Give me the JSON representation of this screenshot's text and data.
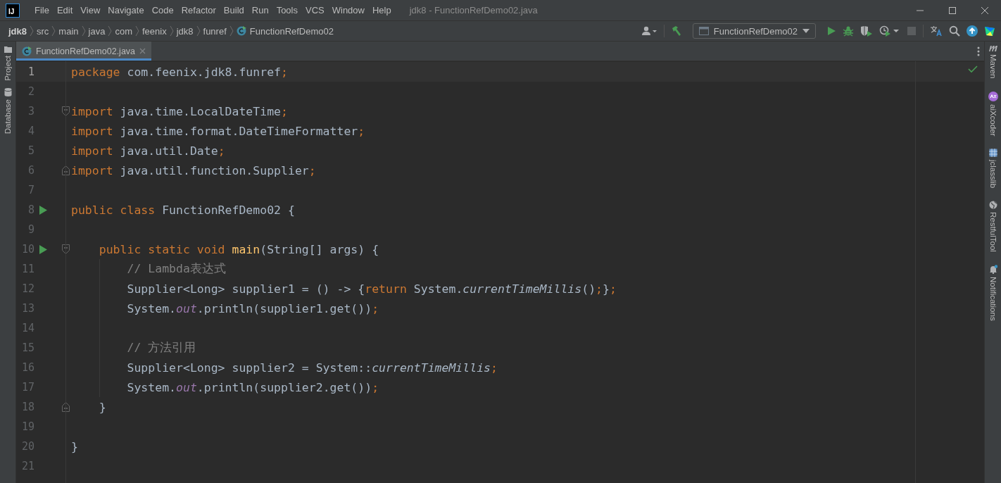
{
  "window": {
    "title": "jdk8 - FunctionRefDemo02.java",
    "logo_text": "IJ"
  },
  "menu": [
    "File",
    "Edit",
    "View",
    "Navigate",
    "Code",
    "Refactor",
    "Build",
    "Run",
    "Tools",
    "VCS",
    "Window",
    "Help"
  ],
  "breadcrumbs": [
    {
      "label": "jdk8",
      "kind": "project"
    },
    {
      "label": "src",
      "kind": "folder"
    },
    {
      "label": "main",
      "kind": "folder"
    },
    {
      "label": "java",
      "kind": "folder"
    },
    {
      "label": "com",
      "kind": "folder"
    },
    {
      "label": "feenix",
      "kind": "folder"
    },
    {
      "label": "jdk8",
      "kind": "folder"
    },
    {
      "label": "funref",
      "kind": "folder"
    },
    {
      "label": "FunctionRefDemo02",
      "kind": "class"
    }
  ],
  "run_config": {
    "label": "FunctionRefDemo02"
  },
  "tabs": [
    {
      "label": "FunctionRefDemo02.java",
      "selected": true
    }
  ],
  "left_tools": [
    "Project",
    "Database"
  ],
  "right_tools": [
    "Maven",
    "aiXcoder",
    "jclasslib",
    "RestfulTool",
    "Notifications"
  ],
  "editor": {
    "lines": [
      {
        "number": "1",
        "current": true,
        "run": false,
        "tokens": [
          {
            "kind": "kw",
            "text": "package"
          },
          {
            "kind": "pl",
            "text": " com.feenix.jdk8.funref"
          },
          {
            "kind": "op",
            "text": ";"
          }
        ]
      },
      {
        "number": "2",
        "current": false,
        "run": false
      },
      {
        "number": "3",
        "current": false,
        "run": false,
        "fold": {
          "kind": "start"
        },
        "tokens": [
          {
            "kind": "kw",
            "text": "import"
          },
          {
            "kind": "pl",
            "text": " java.time.LocalDateTime"
          },
          {
            "kind": "op",
            "text": ";"
          }
        ]
      },
      {
        "number": "4",
        "current": false,
        "run": false,
        "tokens": [
          {
            "kind": "kw",
            "text": "import"
          },
          {
            "kind": "pl",
            "text": " java.time.format.DateTimeFormatter"
          },
          {
            "kind": "op",
            "text": ";"
          }
        ]
      },
      {
        "number": "5",
        "current": false,
        "run": false,
        "tokens": [
          {
            "kind": "kw",
            "text": "import"
          },
          {
            "kind": "pl",
            "text": " java.util.Date"
          },
          {
            "kind": "op",
            "text": ";"
          }
        ]
      },
      {
        "number": "6",
        "current": false,
        "run": false,
        "fold": {
          "kind": "end"
        },
        "tokens": [
          {
            "kind": "kw",
            "text": "import"
          },
          {
            "kind": "pl",
            "text": " java.util.function.Supplier"
          },
          {
            "kind": "op",
            "text": ";"
          }
        ]
      },
      {
        "number": "7",
        "current": false,
        "run": false
      },
      {
        "number": "8",
        "current": false,
        "run": true,
        "tokens": [
          {
            "kind": "kw",
            "text": "public class"
          },
          {
            "kind": "pl",
            "text": " FunctionRefDemo02 {"
          }
        ]
      },
      {
        "number": "9",
        "current": false,
        "run": false
      },
      {
        "number": "10",
        "current": false,
        "run": true,
        "fold": {
          "kind": "start"
        },
        "tokens": [
          {
            "kind": "kw",
            "text": "    public static void"
          },
          {
            "kind": "fn",
            "text": " main"
          },
          {
            "kind": "pl",
            "text": "(String[] args) {"
          }
        ]
      },
      {
        "number": "11",
        "current": false,
        "run": false,
        "tokens": [
          {
            "kind": "cm",
            "text": "        // Lambda表达式"
          }
        ]
      },
      {
        "number": "12",
        "current": false,
        "run": false,
        "tokens": [
          {
            "kind": "pl",
            "text": "        Supplier<Long> supplier1 = () -> {"
          },
          {
            "kind": "kw",
            "text": "return"
          },
          {
            "kind": "pl",
            "text": " System."
          },
          {
            "kind": "st",
            "text": "currentTimeMillis"
          },
          {
            "kind": "pl",
            "text": "()"
          },
          {
            "kind": "op",
            "text": ";"
          },
          {
            "kind": "pl",
            "text": "}"
          },
          {
            "kind": "op",
            "text": ";"
          }
        ]
      },
      {
        "number": "13",
        "current": false,
        "run": false,
        "tokens": [
          {
            "kind": "pl",
            "text": "        System."
          },
          {
            "kind": "fd",
            "text": "out"
          },
          {
            "kind": "pl",
            "text": ".println(supplier1.get())"
          },
          {
            "kind": "op",
            "text": ";"
          }
        ]
      },
      {
        "number": "14",
        "current": false,
        "run": false
      },
      {
        "number": "15",
        "current": false,
        "run": false,
        "tokens": [
          {
            "kind": "cm",
            "text": "        // 方法引用"
          }
        ]
      },
      {
        "number": "16",
        "current": false,
        "run": false,
        "tokens": [
          {
            "kind": "pl",
            "text": "        Supplier<Long> supplier2 = System::"
          },
          {
            "kind": "st",
            "text": "currentTimeMillis"
          },
          {
            "kind": "op",
            "text": ";"
          }
        ]
      },
      {
        "number": "17",
        "current": false,
        "run": false,
        "tokens": [
          {
            "kind": "pl",
            "text": "        System."
          },
          {
            "kind": "fd",
            "text": "out"
          },
          {
            "kind": "pl",
            "text": ".println(supplier2.get())"
          },
          {
            "kind": "op",
            "text": ";"
          }
        ]
      },
      {
        "number": "18",
        "current": false,
        "run": false,
        "fold": {
          "kind": "end"
        },
        "tokens": [
          {
            "kind": "pl",
            "text": "    }"
          }
        ]
      },
      {
        "number": "19",
        "current": false,
        "run": false
      },
      {
        "number": "20",
        "current": false,
        "run": false,
        "tokens": [
          {
            "kind": "pl",
            "text": "}"
          }
        ]
      },
      {
        "number": "21",
        "current": false,
        "run": false
      }
    ]
  }
}
